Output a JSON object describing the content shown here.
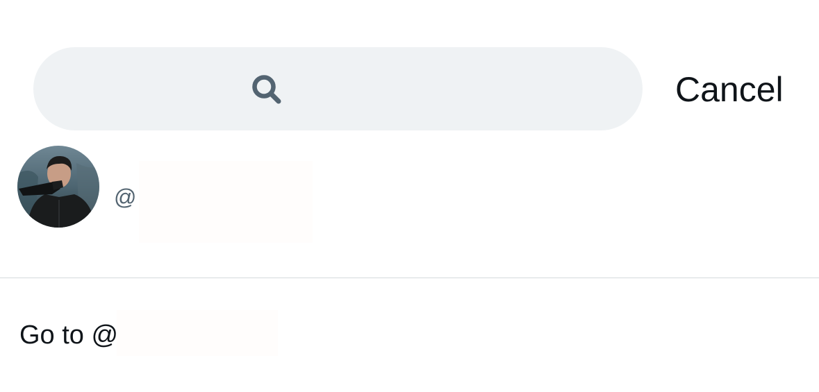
{
  "search": {
    "placeholder": "",
    "value": "",
    "icon": "search-icon",
    "background_color": "#eff2f4",
    "icon_color": "#536471"
  },
  "header": {
    "cancel_label": "Cancel"
  },
  "result": {
    "avatar": "avatar-photo",
    "handle_prefix": "@",
    "handle": "",
    "secondary_text_color": "#536471"
  },
  "goto": {
    "label": "Go to @",
    "handle": ""
  },
  "colors": {
    "text_primary": "#0f1419",
    "divider": "#d4d9dc",
    "background": "#ffffff"
  }
}
